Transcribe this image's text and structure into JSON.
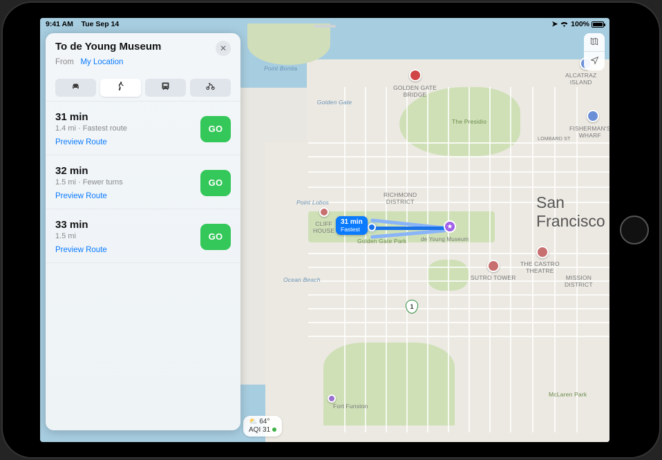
{
  "status_bar": {
    "time": "9:41 AM",
    "date": "Tue Sep 14",
    "battery_pct": "100%"
  },
  "panel": {
    "title": "To de Young Museum",
    "from_label": "From",
    "from_value": "My Location",
    "modes": [
      "car",
      "walk",
      "transit",
      "bike"
    ],
    "active_mode": "walk",
    "preview_label": "Preview Route",
    "go_label": "GO",
    "routes": [
      {
        "time": "31 min",
        "meta": "1.4 mi · Fastest route"
      },
      {
        "time": "32 min",
        "meta": "1.5 mi · Fewer turns"
      },
      {
        "time": "33 min",
        "meta": "1.5 mi"
      }
    ]
  },
  "map": {
    "city": "San Francisco",
    "callout_time": "31 min",
    "callout_sub": "Fastest",
    "dest_label": "de Young Museum",
    "labels": {
      "point_bonita": "Point Bonita",
      "golden_gate": "Golden Gate",
      "ggb": "GOLDEN GATE\nBRIDGE",
      "presidio": "The Presidio",
      "lombard": "LOMBARD ST",
      "alcatraz": "ALCATRAZ\nISLAND",
      "fishermans": "FISHERMAN'S\nWHARF",
      "richmond": "RICHMOND\nDISTRICT",
      "point_lobos": "Point Lobos",
      "cliff": "CLIFF\nHOUSE",
      "ggp": "Golden Gate Park",
      "ocean_beach": "Ocean Beach",
      "sutro": "SUTRO TOWER",
      "castro": "THE CASTRO\nTHEATRE",
      "mission": "MISSION\nDISTRICT",
      "mclaren": "McLaren Park",
      "funston": "Fort Funston"
    },
    "route_shield": "1"
  },
  "weather": {
    "temp": "64°",
    "aqi_label": "AQI 31"
  }
}
